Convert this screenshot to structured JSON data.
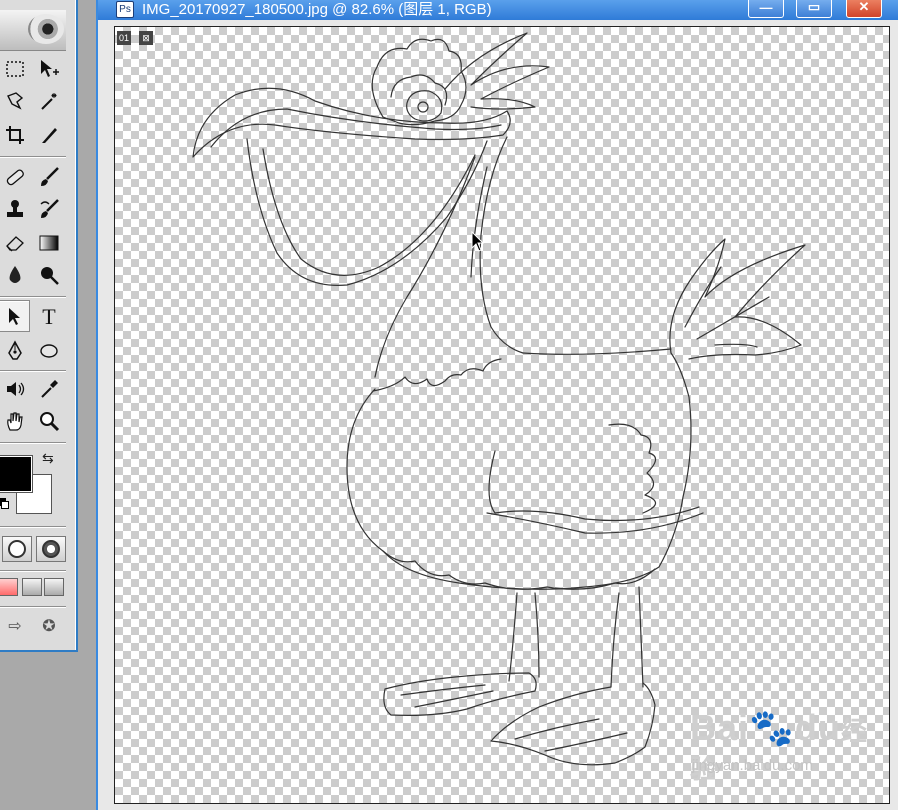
{
  "document": {
    "title": "IMG_20170927_180500.jpg @ 82.6% (图层 1, RGB)",
    "layer_badge": "01",
    "buttons": {
      "minimize": "—",
      "maximize": "▭",
      "close": "✕"
    }
  },
  "toolbox": {
    "tools": [
      {
        "name": "marquee-icon"
      },
      {
        "name": "move-icon"
      },
      {
        "name": "lasso-icon"
      },
      {
        "name": "magic-wand-icon"
      },
      {
        "name": "crop-icon"
      },
      {
        "name": "slice-icon"
      },
      {
        "name": "healing-brush-icon"
      },
      {
        "name": "brush-icon"
      },
      {
        "name": "clone-stamp-icon"
      },
      {
        "name": "history-brush-icon"
      },
      {
        "name": "eraser-icon"
      },
      {
        "name": "gradient-icon"
      },
      {
        "name": "blur-icon"
      },
      {
        "name": "dodge-icon"
      },
      {
        "name": "path-select-icon"
      },
      {
        "name": "type-icon"
      },
      {
        "name": "pen-icon"
      },
      {
        "name": "ellipse-shape-icon"
      },
      {
        "name": "notes-icon"
      },
      {
        "name": "eyedropper-icon"
      },
      {
        "name": "hand-icon"
      },
      {
        "name": "zoom-icon"
      }
    ],
    "type_tool_label": "T",
    "foreground_color": "#000000",
    "background_color": "#ffffff"
  },
  "watermark": {
    "brand": "Bai",
    "brand2": "du",
    "cn": "经验",
    "url": "jingyan.baidu.com"
  },
  "colors": {
    "titlebar": "#2f7bd8",
    "workspace": "#a9a9a9",
    "outline": "#333333"
  }
}
